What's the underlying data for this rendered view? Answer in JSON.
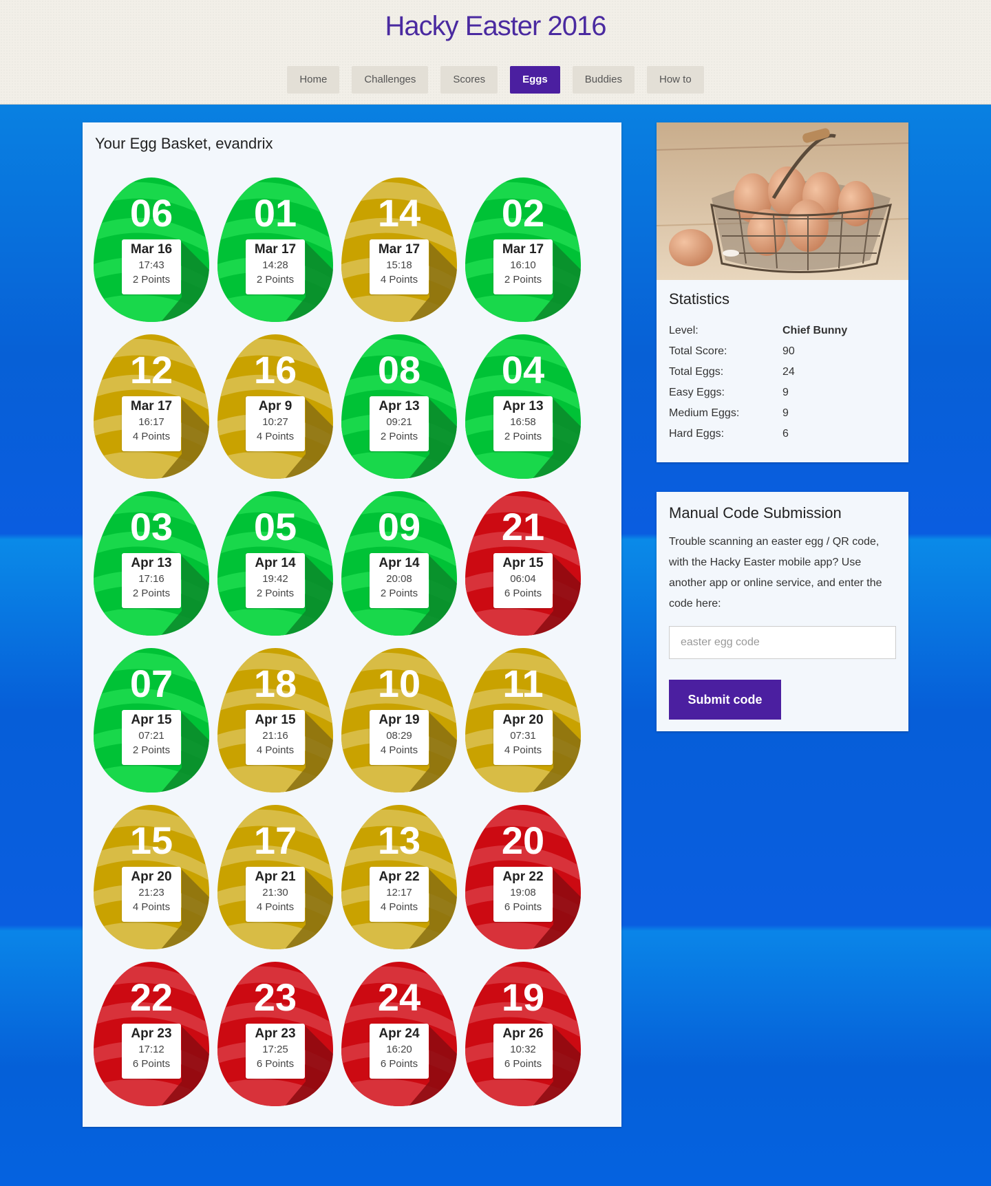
{
  "site": {
    "title": "Hacky Easter 2016"
  },
  "nav": [
    {
      "label": "Home",
      "active": false
    },
    {
      "label": "Challenges",
      "active": false
    },
    {
      "label": "Scores",
      "active": false
    },
    {
      "label": "Eggs",
      "active": true
    },
    {
      "label": "Buddies",
      "active": false
    },
    {
      "label": "How to",
      "active": false
    }
  ],
  "colors": {
    "easy": {
      "base": "#00c236",
      "light": "#19d84b",
      "dark": "#0a8a2a"
    },
    "medium": {
      "base": "#c9a200",
      "light": "#d8bc45",
      "dark": "#8a7010"
    },
    "hard": {
      "base": "#cc0a12",
      "light": "#d8323a",
      "dark": "#8c0a10"
    }
  },
  "basket": {
    "title": "Your Egg Basket, evandrix",
    "eggs": [
      {
        "num": "06",
        "date": "Mar 16",
        "time": "17:43",
        "points": "2 Points",
        "level": "easy"
      },
      {
        "num": "01",
        "date": "Mar 17",
        "time": "14:28",
        "points": "2 Points",
        "level": "easy"
      },
      {
        "num": "14",
        "date": "Mar 17",
        "time": "15:18",
        "points": "4 Points",
        "level": "medium"
      },
      {
        "num": "02",
        "date": "Mar 17",
        "time": "16:10",
        "points": "2 Points",
        "level": "easy"
      },
      {
        "num": "12",
        "date": "Mar 17",
        "time": "16:17",
        "points": "4 Points",
        "level": "medium"
      },
      {
        "num": "16",
        "date": "Apr 9",
        "time": "10:27",
        "points": "4 Points",
        "level": "medium"
      },
      {
        "num": "08",
        "date": "Apr 13",
        "time": "09:21",
        "points": "2 Points",
        "level": "easy"
      },
      {
        "num": "04",
        "date": "Apr 13",
        "time": "16:58",
        "points": "2 Points",
        "level": "easy"
      },
      {
        "num": "03",
        "date": "Apr 13",
        "time": "17:16",
        "points": "2 Points",
        "level": "easy"
      },
      {
        "num": "05",
        "date": "Apr 14",
        "time": "19:42",
        "points": "2 Points",
        "level": "easy"
      },
      {
        "num": "09",
        "date": "Apr 14",
        "time": "20:08",
        "points": "2 Points",
        "level": "easy"
      },
      {
        "num": "21",
        "date": "Apr 15",
        "time": "06:04",
        "points": "6 Points",
        "level": "hard"
      },
      {
        "num": "07",
        "date": "Apr 15",
        "time": "07:21",
        "points": "2 Points",
        "level": "easy"
      },
      {
        "num": "18",
        "date": "Apr 15",
        "time": "21:16",
        "points": "4 Points",
        "level": "medium"
      },
      {
        "num": "10",
        "date": "Apr 19",
        "time": "08:29",
        "points": "4 Points",
        "level": "medium"
      },
      {
        "num": "11",
        "date": "Apr 20",
        "time": "07:31",
        "points": "4 Points",
        "level": "medium"
      },
      {
        "num": "15",
        "date": "Apr 20",
        "time": "21:23",
        "points": "4 Points",
        "level": "medium"
      },
      {
        "num": "17",
        "date": "Apr 21",
        "time": "21:30",
        "points": "4 Points",
        "level": "medium"
      },
      {
        "num": "13",
        "date": "Apr 22",
        "time": "12:17",
        "points": "4 Points",
        "level": "medium"
      },
      {
        "num": "20",
        "date": "Apr 22",
        "time": "19:08",
        "points": "6 Points",
        "level": "hard"
      },
      {
        "num": "22",
        "date": "Apr 23",
        "time": "17:12",
        "points": "6 Points",
        "level": "hard"
      },
      {
        "num": "23",
        "date": "Apr 23",
        "time": "17:25",
        "points": "6 Points",
        "level": "hard"
      },
      {
        "num": "24",
        "date": "Apr 24",
        "time": "16:20",
        "points": "6 Points",
        "level": "hard"
      },
      {
        "num": "19",
        "date": "Apr 26",
        "time": "10:32",
        "points": "6 Points",
        "level": "hard"
      }
    ]
  },
  "stats": {
    "title": "Statistics",
    "rows": [
      {
        "label": "Level:",
        "value": "Chief Bunny"
      },
      {
        "label": "Total Score:",
        "value": "90"
      },
      {
        "label": "Total Eggs:",
        "value": "24"
      },
      {
        "label": "Easy Eggs:",
        "value": "9"
      },
      {
        "label": "Medium Eggs:",
        "value": "9"
      },
      {
        "label": "Hard Eggs:",
        "value": "6"
      }
    ]
  },
  "manual": {
    "title": "Manual Code Submission",
    "text": "Trouble scanning an easter egg / QR code, with the Hacky Easter mobile app? Use another app or online service, and enter the code here:",
    "placeholder": "easter egg code",
    "button": "Submit code"
  }
}
